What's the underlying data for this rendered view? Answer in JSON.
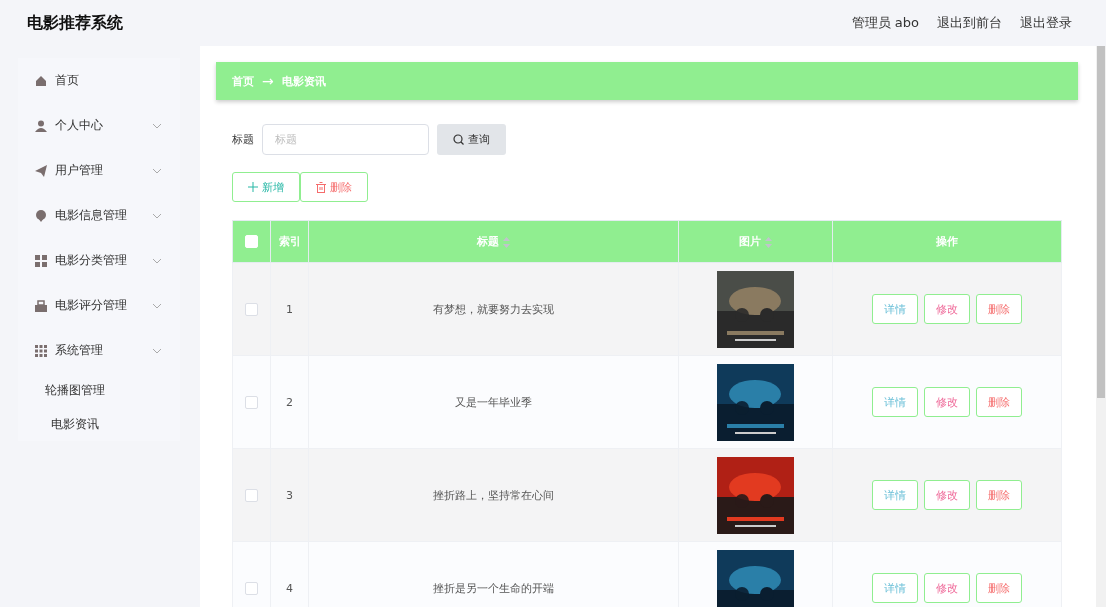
{
  "header": {
    "title": "电影推荐系统",
    "links": [
      {
        "label": "管理员 abo"
      },
      {
        "label": "退出到前台"
      },
      {
        "label": "退出登录"
      }
    ]
  },
  "sidebar": {
    "items": [
      {
        "label": "首页",
        "has_submenu": false
      },
      {
        "label": "个人中心",
        "has_submenu": true
      },
      {
        "label": "用户管理",
        "has_submenu": true
      },
      {
        "label": "电影信息管理",
        "has_submenu": true
      },
      {
        "label": "电影分类管理",
        "has_submenu": true
      },
      {
        "label": "电影评分管理",
        "has_submenu": true
      },
      {
        "label": "系统管理",
        "has_submenu": true,
        "children": [
          {
            "label": "轮播图管理"
          },
          {
            "label": "电影资讯"
          }
        ]
      }
    ]
  },
  "breadcrumb": [
    "首页",
    "电影资讯"
  ],
  "breadcrumb_separator": "→",
  "search": {
    "label": "标题",
    "placeholder": "标题",
    "button": "查询"
  },
  "actions": [
    {
      "kind": "add",
      "label": "新增"
    },
    {
      "kind": "delete",
      "label": "删除"
    }
  ],
  "table": {
    "select_all": {
      "checked": false
    },
    "columns": [
      {
        "label": "索引",
        "sortable": false
      },
      {
        "label": "标题",
        "sortable": true
      },
      {
        "label": "图片",
        "sortable": true
      },
      {
        "label": "操作",
        "sortable": false
      }
    ],
    "rows": [
      {
        "checked": false,
        "index": "1",
        "title": "有梦想，就要努力去实现",
        "image": {
          "kind": "picture"
        },
        "buttons": [
          {
            "kind": "detail",
            "label": "详情"
          },
          {
            "kind": "edit",
            "label": "修改"
          },
          {
            "kind": "delete",
            "label": "删除"
          }
        ]
      },
      {
        "checked": false,
        "index": "2",
        "title": "又是一年毕业季",
        "image": {
          "kind": "picture"
        },
        "buttons": [
          {
            "kind": "detail",
            "label": "详情"
          },
          {
            "kind": "edit",
            "label": "修改"
          },
          {
            "kind": "delete",
            "label": "删除"
          }
        ]
      },
      {
        "checked": false,
        "index": "3",
        "title": "挫折路上，坚持常在心间",
        "image": {
          "kind": "picture"
        },
        "buttons": [
          {
            "kind": "detail",
            "label": "详情"
          },
          {
            "kind": "edit",
            "label": "修改"
          },
          {
            "kind": "delete",
            "label": "删除"
          }
        ]
      },
      {
        "checked": false,
        "index": "4",
        "title": "挫折是另一个生命的开端",
        "image": {
          "kind": "picture"
        },
        "buttons": [
          {
            "kind": "detail",
            "label": "详情"
          },
          {
            "kind": "edit",
            "label": "修改"
          },
          {
            "kind": "delete",
            "label": "删除"
          }
        ]
      }
    ]
  }
}
